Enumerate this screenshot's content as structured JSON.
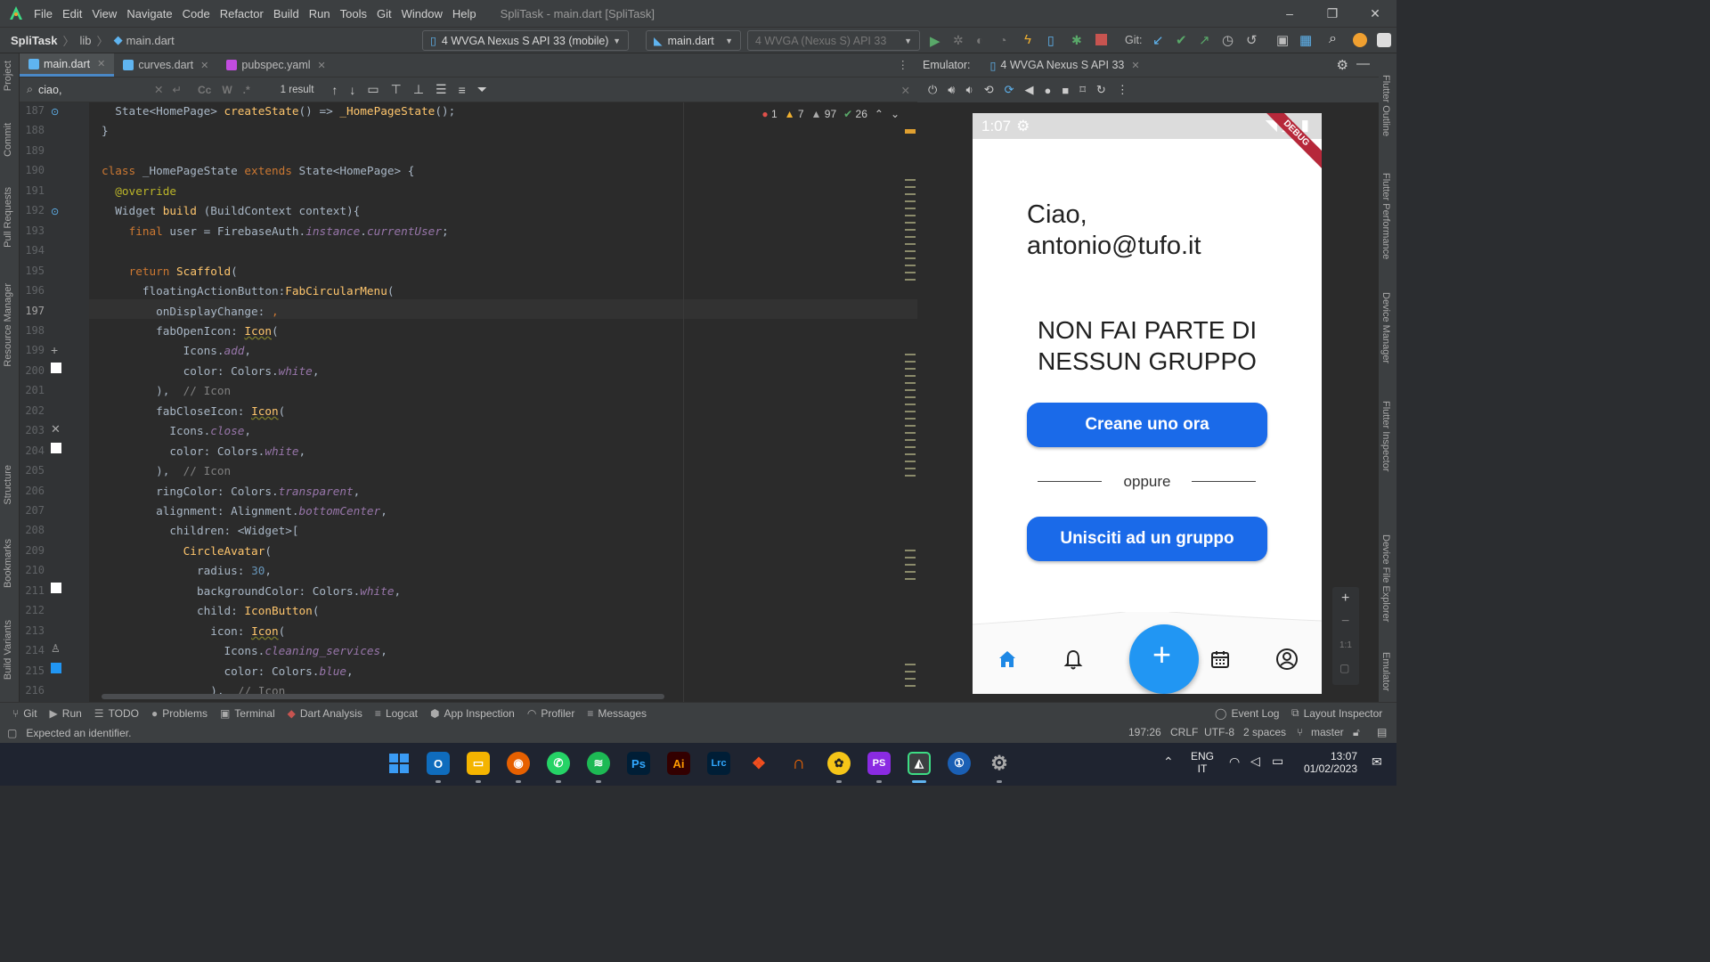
{
  "window": {
    "menu": [
      "File",
      "Edit",
      "View",
      "Navigate",
      "Code",
      "Refactor",
      "Build",
      "Run",
      "Tools",
      "Git",
      "Window",
      "Help"
    ],
    "title": "SpliTask - main.dart [SpliTask]",
    "controls": {
      "minimize": "–",
      "restore": "❐",
      "close": "✕"
    }
  },
  "nav": {
    "project": "SpliTask",
    "folder": "lib",
    "file": "main.dart",
    "device_combo": "4 WVGA Nexus S API 33 (mobile)",
    "run_config": "main.dart",
    "device_disabled": "4  WVGA (Nexus S) API 33",
    "git_label": "Git:"
  },
  "left_stripe": [
    "Project",
    "Commit",
    "Pull Requests",
    "Resource Manager",
    "Structure",
    "Bookmarks",
    "Build Variants"
  ],
  "right_stripe": [
    "Flutter Outline",
    "Flutter Performance",
    "Device Manager",
    "Flutter Inspector",
    "Device File Explorer",
    "Emulator"
  ],
  "tabs": [
    {
      "label": "main.dart",
      "active": true,
      "color": "#5fb4f0"
    },
    {
      "label": "curves.dart",
      "active": false,
      "color": "#5fb4f0"
    },
    {
      "label": "pubspec.yaml",
      "active": false,
      "color": "#c24ce0"
    }
  ],
  "search": {
    "value": "ciao,",
    "opts": [
      "Cc",
      "W",
      ".*"
    ],
    "result": "1 result"
  },
  "inspections": {
    "errors": "1",
    "warnings": "7",
    "weak": "97",
    "ok": "26"
  },
  "code": {
    "lines": [
      {
        "n": "187",
        "html": "  State&lt;HomePage&gt; <span class='fn'>createState</span>() =&gt; <span class='fn'>_HomePageState</span>();"
      },
      {
        "n": "188",
        "html": "}"
      },
      {
        "n": "189",
        "html": ""
      },
      {
        "n": "190",
        "html": "<span class='kw'>class</span> _HomePageState <span class='kw'>extends</span> State&lt;HomePage&gt; {"
      },
      {
        "n": "191",
        "html": "  <span class='an'>@override</span>"
      },
      {
        "n": "192",
        "html": "  Widget <span class='fn'>build</span> (BuildContext context){"
      },
      {
        "n": "193",
        "html": "    <span class='kw'>final</span> user = FirebaseAuth.<span class='it'>instance</span>.<span class='it'>currentUser</span>;"
      },
      {
        "n": "194",
        "html": ""
      },
      {
        "n": "195",
        "html": "    <span class='kw'>return</span> <span class='fn'>Scaffold</span>("
      },
      {
        "n": "196",
        "html": "      floatingActionButton:<span class='fn'>FabCircularMenu</span>("
      },
      {
        "n": "197",
        "html": "        onDisplayChange: <span class='kw'>,</span>"
      },
      {
        "n": "198",
        "html": "        fabOpenIcon: <span class='fn ul'>Icon</span>("
      },
      {
        "n": "199",
        "html": "            Icons.<span class='it'>add</span>,"
      },
      {
        "n": "200",
        "html": "            color: Colors.<span class='it'>white</span>,"
      },
      {
        "n": "201",
        "html": "        ),  <span class='cm'>// Icon</span>"
      },
      {
        "n": "202",
        "html": "        fabCloseIcon: <span class='fn ul'>Icon</span>("
      },
      {
        "n": "203",
        "html": "          Icons.<span class='it'>close</span>,"
      },
      {
        "n": "204",
        "html": "          color: Colors.<span class='it'>white</span>,"
      },
      {
        "n": "205",
        "html": "        ),  <span class='cm'>// Icon</span>"
      },
      {
        "n": "206",
        "html": "        ringColor: Colors.<span class='it'>transparent</span>,"
      },
      {
        "n": "207",
        "html": "        alignment: Alignment.<span class='it'>bottomCenter</span>,"
      },
      {
        "n": "208",
        "html": "          children: &lt;Widget&gt;["
      },
      {
        "n": "209",
        "html": "            <span class='fn'>CircleAvatar</span>("
      },
      {
        "n": "210",
        "html": "              radius: <span class='num'>30</span>,"
      },
      {
        "n": "211",
        "html": "              backgroundColor: Colors.<span class='it'>white</span>,"
      },
      {
        "n": "212",
        "html": "              child: <span class='fn'>IconButton</span>("
      },
      {
        "n": "213",
        "html": "                icon: <span class='fn ul'>Icon</span>("
      },
      {
        "n": "214",
        "html": "                  Icons.<span class='it'>cleaning_services</span>,"
      },
      {
        "n": "215",
        "html": "                  color: Colors.<span class='it'>blue</span>,"
      },
      {
        "n": "216",
        "html": "                ),  <span class='cm'>// Icon</span>"
      }
    ],
    "current_line": "197"
  },
  "toolwindows": [
    "Git",
    "Run",
    "TODO",
    "Problems",
    "Terminal",
    "Dart Analysis",
    "Logcat",
    "App Inspection",
    "Profiler",
    "Messages"
  ],
  "toolwindows_right": [
    "Event Log",
    "Layout Inspector"
  ],
  "status": {
    "message": "Expected an identifier.",
    "position": "197:26",
    "line_sep": "CRLF",
    "encoding": "UTF-8",
    "indent": "2 spaces",
    "branch": "master"
  },
  "emulator": {
    "label": "Emulator:",
    "device_tab": "4 WVGA Nexus S API 33",
    "zoom_label": "1:1"
  },
  "phone": {
    "time": "1:07",
    "debug_banner": "DEBUG",
    "greeting_line1": "Ciao,",
    "greeting_line2": "antonio@tufo.it",
    "title_line1": "NON FAI PARTE DI",
    "title_line2": "NESSUN GRUPPO",
    "create_button": "Creane uno ora",
    "or_text": "oppure",
    "join_button": "Unisciti ad un gruppo",
    "accent": "#1a6ae9",
    "fab_color": "#2196f3"
  },
  "taskbar": {
    "apps": [
      "windows",
      "outlook",
      "explorer",
      "firefox",
      "whatsapp",
      "spotify",
      "Ps",
      "Ai",
      "Lrc",
      "figma",
      "headset",
      "hive",
      "PS",
      "android-studio",
      "1password",
      "settings"
    ],
    "lang1": "ENG",
    "lang2": "IT",
    "time": "13:07",
    "date": "01/02/2023"
  }
}
